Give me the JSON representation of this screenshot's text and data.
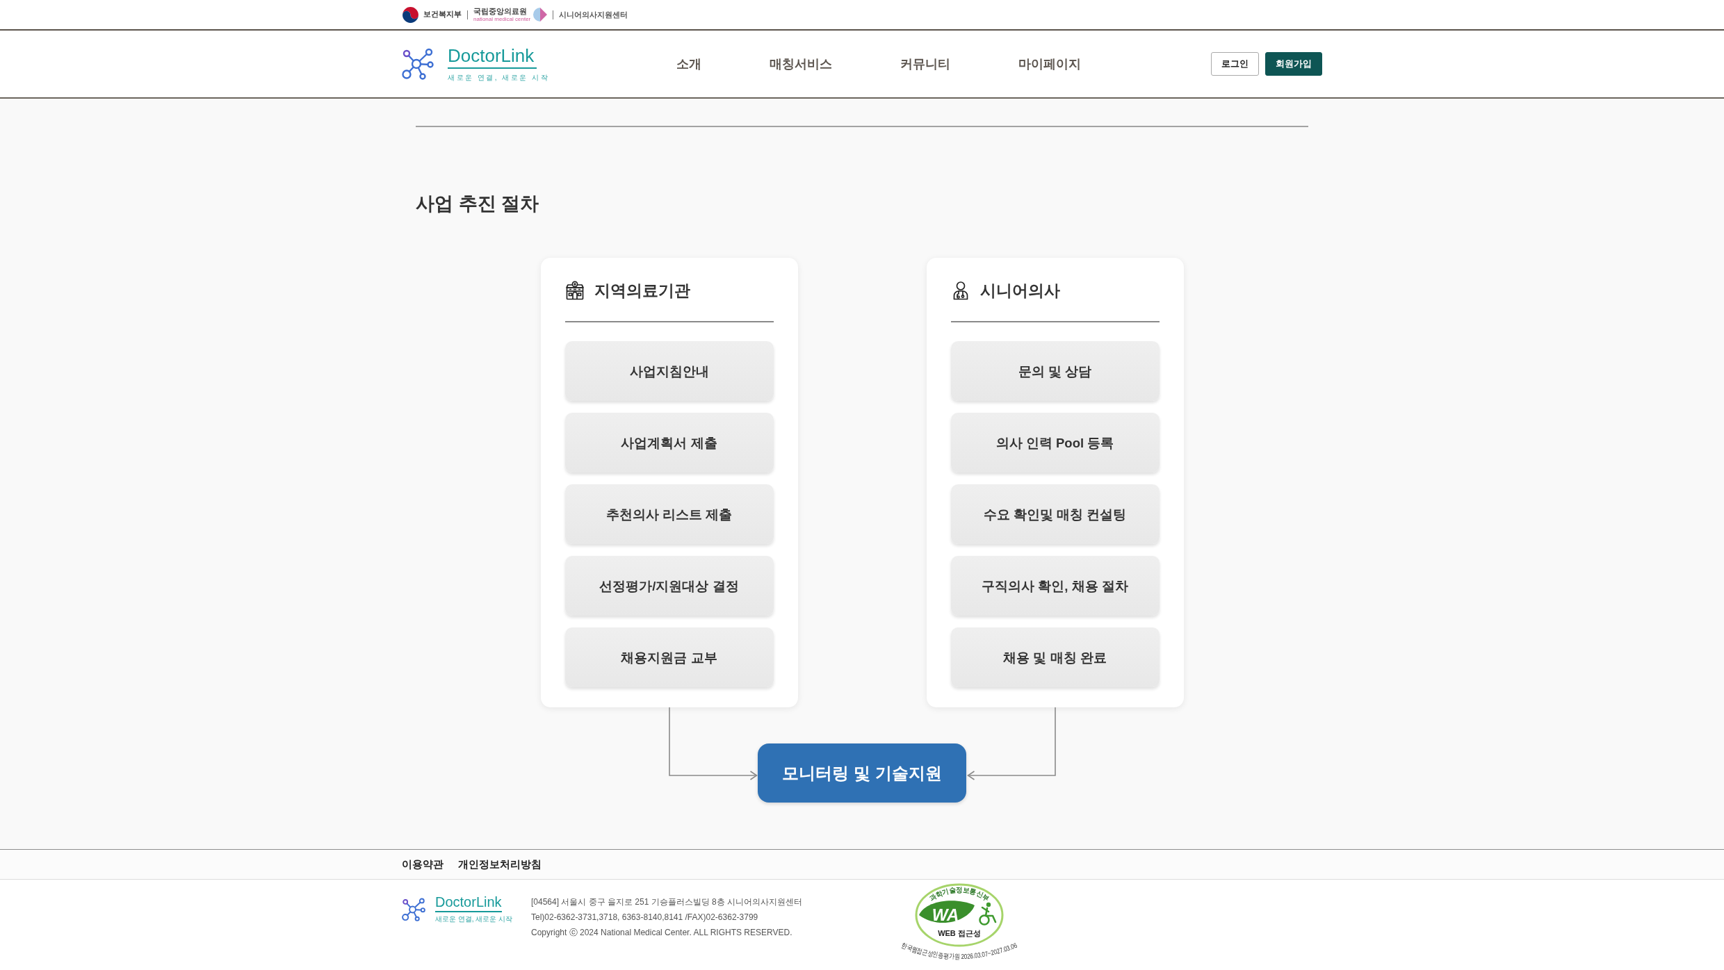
{
  "top_bar": {
    "ministry": "보건복지부",
    "institute": {
      "name": "국립중앙의료원",
      "subtitle": "national medical center"
    },
    "center": "시니어의사지원센터"
  },
  "header": {
    "logo": {
      "name": "DoctorLink",
      "tagline": "새로운 연결, 새로운 시작"
    },
    "nav": [
      "소개",
      "매칭서비스",
      "커뮤니티",
      "마이페이지"
    ],
    "buttons": [
      {
        "label": "로그인",
        "kind": "outline"
      },
      {
        "label": "회원가입",
        "kind": "filled"
      }
    ]
  },
  "page": {
    "title": "사업 추진 절차",
    "tracks": [
      {
        "title": "지역의료기관",
        "kind": "institution",
        "steps": [
          "사업지침안내",
          "사업계획서 제출",
          "추천의사 리스트 제출",
          "선정평가/지원대상 결정",
          "채용지원금 교부"
        ]
      },
      {
        "title": "시니어의사",
        "kind": "physician",
        "steps": [
          "문의 및 상담",
          "의사 인력 Pool 등록",
          "수요 확인및 매칭 컨설팅",
          "구직의사 확인, 채용 절차",
          "채용 및 매칭 완료"
        ]
      }
    ],
    "final_step": "모니터링 및 기술지원"
  },
  "footer": {
    "links": [
      "이용약관",
      "개인정보처리방침"
    ],
    "logo": {
      "name": "DoctorLink",
      "tagline": "새로운 연결, 새로운 시작"
    },
    "address_lines": [
      "[04564] 서울시 중구 을지로 251 기승플러스빌딩 8층 시니어의사지원센터",
      "Tel)02-6362-3731,3718, 6363-8140,8141 /FAX)02-6362-3799",
      "Copyright ⓒ 2024 National Medical Center. ALL RIGHTS RESERVED."
    ],
    "badge": {
      "top_text": "과학기술정보통신부",
      "mark": "WA",
      "label": "WEB 접근성",
      "bottom_text": "한국웹접근성인증평가원 2026.03.07~2027.03.06"
    }
  }
}
